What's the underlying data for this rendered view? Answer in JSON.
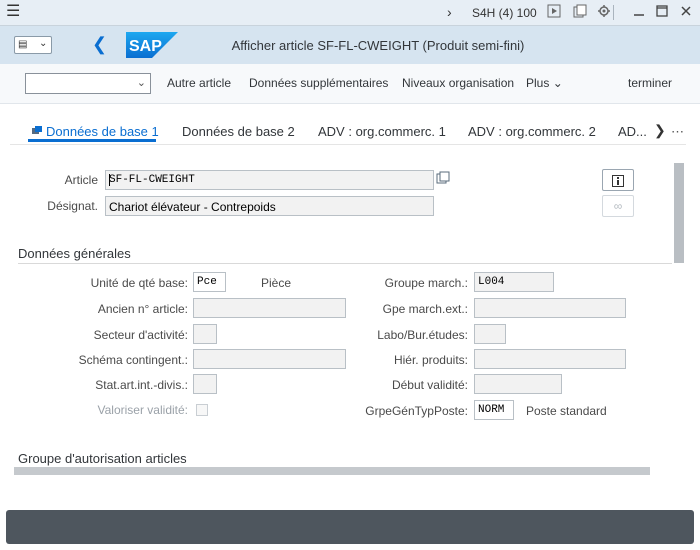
{
  "system_bar": {
    "system_label": "S4H (4) 100",
    "icons": [
      "menu-icon",
      "chevron-right-icon",
      "play-icon",
      "copy-icon",
      "settings-icon",
      "minimize-icon",
      "maximize-icon",
      "close-icon"
    ]
  },
  "title_bar": {
    "title": "Afficher article SF-FL-CWEIGHT (Produit semi-fini)",
    "logo_text": "SAP",
    "brand_color": "#0a6ed1"
  },
  "toolbar": {
    "okcode_value": "",
    "buttons": [
      "Autre article",
      "Données supplémentaires",
      "Niveaux organisation",
      "Plus"
    ],
    "finish": "terminer"
  },
  "tabs": {
    "items": [
      "Données de base 1",
      "Données de base 2",
      "ADV : org.commerc. 1",
      "ADV : org.commerc. 2",
      "AD..."
    ],
    "active_index": 0
  },
  "header": {
    "article_label": "Article",
    "article_value": "SF-FL-CWEIGHT",
    "designation_label": "Désignat.",
    "designation_value": "Chariot élévateur - Contrepoids"
  },
  "general": {
    "section_title": "Données générales",
    "unit_label": "Unité de qté base:",
    "unit_value": "Pce",
    "unit_text": "Pièce",
    "old_article_label": "Ancien n° article:",
    "old_article_value": "",
    "sector_label": "Secteur d'activité:",
    "sector_value": "",
    "schema_label": "Schéma contingent.:",
    "schema_value": "",
    "stat_label": "Stat.art.int.-divis.:",
    "stat_value": "",
    "valuate_label": "Valoriser validité:",
    "valuate_checked": false,
    "group_label": "Groupe march.:",
    "group_value": "L004",
    "group_ext_label": "Gpe march.ext.:",
    "group_ext_value": "",
    "lab_label": "Labo/Bur.études:",
    "lab_value": "",
    "hier_label": "Hiér. produits:",
    "hier_value": "",
    "start_label": "Début validité:",
    "start_value": "",
    "item_cat_label": "GrpeGénTypPoste:",
    "item_cat_value": "NORM",
    "item_cat_text": "Poste standard"
  },
  "authorization": {
    "section_title": "Groupe d'autorisation articles"
  }
}
